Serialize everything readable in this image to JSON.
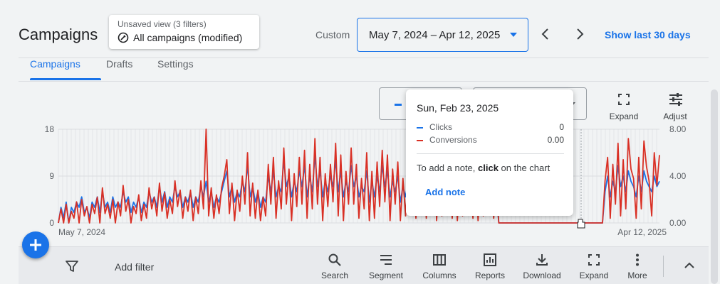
{
  "header": {
    "title": "Campaigns",
    "view_sub": "Unsaved view (3 filters)",
    "view_main": "All campaigns (modified)",
    "custom_label": "Custom",
    "date_range": "May 7, 2024 – Apr 12, 2025",
    "show_last": "Show last 30 days"
  },
  "tabs": [
    {
      "label": "Campaigns",
      "active": true
    },
    {
      "label": "Drafts",
      "active": false
    },
    {
      "label": "Settings",
      "active": false
    }
  ],
  "chart_tools": {
    "expand": "Expand",
    "adjust": "Adjust"
  },
  "tooltip": {
    "date": "Sun, Feb 23, 2025",
    "rows": [
      {
        "name": "Clicks",
        "value": "0",
        "color": "#1a73e8"
      },
      {
        "name": "Conversions",
        "value": "0.00",
        "color": "#d93025"
      }
    ],
    "note_pre": "To add a note, ",
    "note_bold": "click",
    "note_post": " on the chart",
    "add_note": "Add note"
  },
  "toolbar": {
    "add_filter": "Add filter",
    "buttons": [
      {
        "label": "Search",
        "icon": "search-icon"
      },
      {
        "label": "Segment",
        "icon": "segment-icon"
      },
      {
        "label": "Columns",
        "icon": "columns-icon"
      },
      {
        "label": "Reports",
        "icon": "reports-icon"
      },
      {
        "label": "Download",
        "icon": "download-icon"
      },
      {
        "label": "Expand",
        "icon": "expand-icon"
      },
      {
        "label": "More",
        "icon": "more-vert-icon"
      }
    ]
  },
  "colors": {
    "clicks": "#1a73e8",
    "conversions": "#d93025",
    "accent": "#1a73e8"
  },
  "chart_data": {
    "type": "line",
    "x_start_label": "May 7, 2024",
    "x_end_label": "Apr 12, 2025",
    "y_left_ticks": [
      "18",
      "9",
      "0"
    ],
    "y_right_ticks": [
      "8.00",
      "4.00",
      "0.00"
    ],
    "ylim_left": [
      0,
      18
    ],
    "ylim_right": [
      0,
      8
    ],
    "series": [
      {
        "name": "Clicks",
        "axis": "left",
        "values": [
          0,
          3,
          1,
          4,
          0,
          3,
          2,
          4,
          3,
          5,
          2,
          3,
          1,
          4,
          3,
          5,
          2,
          6,
          3,
          4,
          2,
          5,
          3,
          4,
          3,
          6,
          4,
          5,
          2,
          4,
          3,
          5,
          2,
          4,
          3,
          6,
          4,
          5,
          3,
          7,
          4,
          6,
          3,
          5,
          4,
          7,
          5,
          6,
          3,
          5,
          4,
          6,
          3,
          5,
          4,
          7,
          5,
          8,
          4,
          6,
          3,
          5,
          4,
          6,
          8,
          10,
          5,
          7,
          4,
          6,
          5,
          8,
          6,
          11,
          5,
          7,
          4,
          6,
          3,
          5,
          4,
          9,
          6,
          10,
          5,
          7,
          6,
          12,
          7,
          9,
          5,
          8,
          6,
          10,
          7,
          11,
          5,
          9,
          6,
          13,
          7,
          10,
          5,
          8,
          6,
          9,
          7,
          12,
          6,
          10,
          5,
          8,
          6,
          11,
          7,
          9,
          5,
          7,
          6,
          10,
          4,
          8,
          5,
          9,
          6,
          11,
          7,
          10,
          5,
          8,
          6,
          9,
          4,
          7,
          5,
          8,
          6,
          10,
          5,
          9,
          6,
          8,
          5,
          7,
          6,
          9,
          4,
          8,
          5,
          7,
          6,
          8,
          5,
          9,
          4,
          7,
          5,
          8,
          6,
          7,
          5,
          9,
          4,
          8,
          5,
          7,
          6,
          8,
          5,
          6,
          0,
          0,
          0,
          0,
          0,
          0,
          0,
          0,
          0,
          0,
          0,
          0,
          0,
          0,
          0,
          0,
          0,
          0,
          0,
          0,
          0,
          0,
          0,
          0,
          0,
          0,
          0,
          0,
          0,
          0,
          0,
          0,
          0,
          0,
          0,
          0,
          0,
          0,
          0,
          0,
          0,
          6,
          9,
          5,
          8,
          6,
          11,
          7,
          9,
          6,
          10,
          8,
          7,
          5,
          9,
          6,
          10,
          8,
          7,
          6,
          9,
          7,
          8
        ]
      },
      {
        "name": "Conversions",
        "axis": "right",
        "values": [
          0,
          1.2,
          0,
          1.6,
          0,
          1.0,
          0.4,
          1.8,
          0,
          2.0,
          0.6,
          1.4,
          0,
          1.6,
          0.8,
          2.2,
          0,
          3.0,
          0.8,
          1.6,
          0.4,
          2.0,
          0,
          1.8,
          0.6,
          3.2,
          1.0,
          2.0,
          0,
          1.4,
          0.8,
          2.4,
          0.2,
          1.6,
          0.4,
          3.0,
          1.2,
          2.2,
          0.6,
          3.4,
          1.0,
          2.6,
          0.4,
          2.0,
          0.8,
          3.6,
          1.4,
          2.8,
          0.4,
          2.2,
          1.0,
          2.8,
          0.2,
          2.2,
          0.8,
          3.6,
          1.2,
          8.0,
          0.6,
          3.0,
          0.4,
          2.4,
          0.8,
          3.0,
          4.0,
          5.4,
          0.8,
          3.4,
          0.2,
          2.8,
          1.0,
          4.0,
          1.6,
          6.0,
          0.6,
          3.4,
          0.4,
          2.8,
          0.2,
          2.2,
          0.6,
          5.0,
          1.6,
          5.6,
          0.4,
          3.6,
          1.2,
          6.4,
          1.6,
          4.6,
          0.2,
          4.2,
          1.4,
          5.6,
          1.6,
          6.2,
          0.4,
          5.0,
          1.2,
          7.2,
          1.6,
          5.6,
          0.2,
          4.2,
          1.4,
          5.0,
          1.8,
          6.8,
          0.6,
          5.8,
          0.2,
          4.4,
          1.6,
          6.4,
          1.6,
          5.0,
          0.4,
          3.8,
          1.2,
          6.0,
          0.2,
          4.4,
          0.4,
          5.2,
          1.4,
          6.2,
          1.8,
          5.8,
          0.2,
          4.6,
          1.6,
          5.2,
          0.2,
          3.8,
          0.6,
          4.6,
          1.4,
          5.6,
          0.4,
          5.2,
          1.6,
          4.4,
          0.4,
          3.8,
          1.4,
          5.0,
          0.2,
          4.6,
          0.6,
          3.8,
          1.6,
          4.4,
          0.4,
          5.0,
          0.2,
          3.8,
          0.6,
          4.4,
          1.6,
          3.8,
          0.4,
          5.2,
          0.2,
          4.4,
          0.6,
          3.8,
          1.4,
          4.6,
          0.4,
          3.2,
          0,
          0,
          0,
          0,
          0,
          0,
          0,
          0,
          0,
          0,
          0,
          0,
          0,
          0,
          0,
          0,
          0,
          0,
          0,
          0,
          0,
          0,
          0,
          0,
          0,
          0,
          0,
          0,
          0,
          0,
          0,
          0,
          0,
          0,
          0,
          0,
          0,
          0,
          0,
          0,
          0,
          3.6,
          5.6,
          0.4,
          5.0,
          1.6,
          6.8,
          0.6,
          5.4,
          1.2,
          7.2,
          4.6,
          3.8,
          0.4,
          5.6,
          1.2,
          7.0,
          4.8,
          3.6,
          0.6,
          6.0,
          3.2,
          5.8
        ]
      }
    ],
    "grid": true,
    "legend": "none"
  }
}
